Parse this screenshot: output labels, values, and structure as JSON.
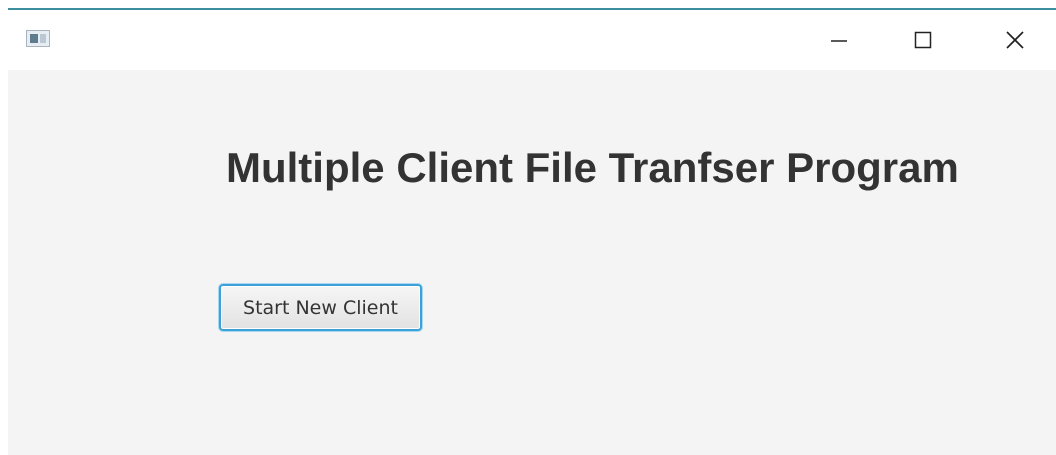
{
  "window": {
    "app_icon": "window-app-icon",
    "controls": {
      "minimize_icon": "minimize-icon",
      "maximize_icon": "maximize-icon",
      "close_icon": "close-icon"
    },
    "accent_color": "#3d8fa0"
  },
  "main": {
    "title": "Multiple Client File Tranfser Program",
    "start_button_label": "Start New Client"
  }
}
